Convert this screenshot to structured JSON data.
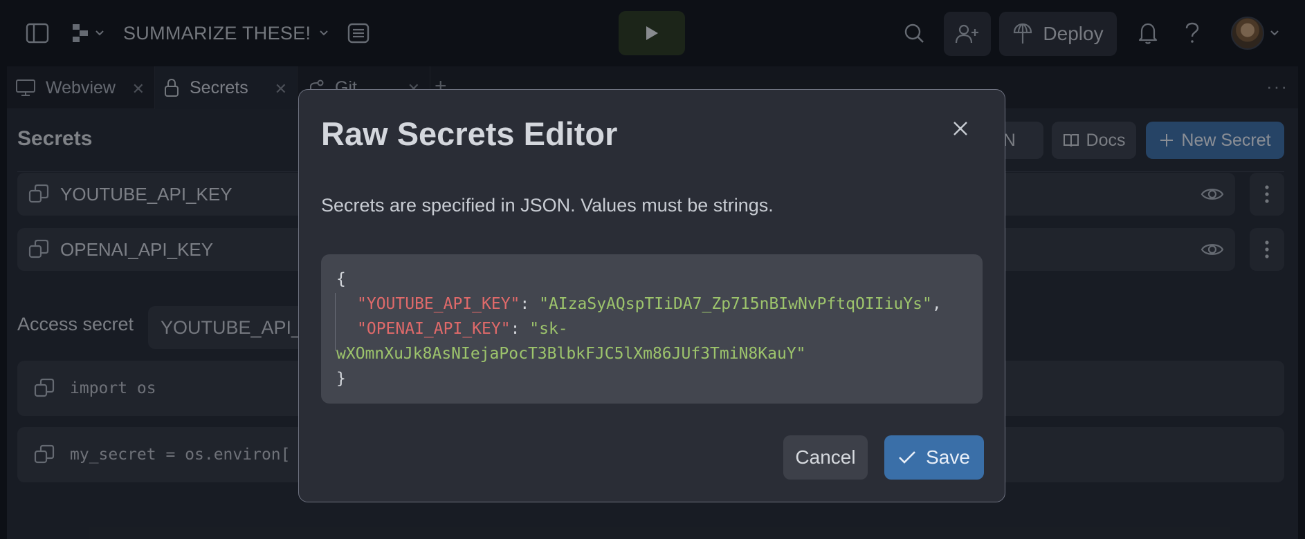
{
  "topbar": {
    "project_title": "SUMMARIZE THESE!",
    "deploy_label": "Deploy",
    "icons": {
      "sidebar": "sidebar-toggle-icon",
      "repl": "repl-icon",
      "tasks": "tasks-icon",
      "run": "play-icon",
      "search": "search-icon",
      "invite": "add-user-icon",
      "deploy": "deploy-icon",
      "bell": "bell-icon",
      "help": "help-icon"
    },
    "run_color": "#2c3a22",
    "run_icon_color": "#e6e8ec"
  },
  "tabs": [
    {
      "label": "Webview",
      "icon": "monitor-icon"
    },
    {
      "label": "Secrets",
      "icon": "lock-icon",
      "active": true
    },
    {
      "label": "Git",
      "icon": "git-icon"
    }
  ],
  "secrets_pane": {
    "title": "Secrets",
    "edit_as_json_label": "ON",
    "docs_label": "Docs",
    "new_secret_label": "New Secret",
    "rows": [
      {
        "key": "YOUTUBE_API_KEY"
      },
      {
        "key": "OPENAI_API_KEY"
      }
    ],
    "access_secret_label": "Access secret",
    "access_secret_value": "YOUTUBE_API_",
    "code_lines": [
      "import os",
      "my_secret = os.environ["
    ]
  },
  "modal": {
    "title": "Raw Secrets Editor",
    "description": "Secrets are specified in JSON. Values must be strings.",
    "editor": {
      "open_brace": "{",
      "close_brace": "}",
      "entries": [
        {
          "key": "\"YOUTUBE_API_KEY\"",
          "sep": ": ",
          "value": "\"AIzaSyAQspTIiDA7_Zp715nBIwNvPftqOIIiuYs\"",
          "trail": ","
        },
        {
          "key": "\"OPENAI_API_KEY\"",
          "sep": ": ",
          "value_part1": "\"sk-",
          "value_part2": "wXOmnXuJk8AsNIejaPocT3BlbkFJC5lXm86JUf3TmiN8KauY\""
        }
      ]
    },
    "cancel_label": "Cancel",
    "save_label": "Save",
    "accent_color": "#3a6fa8"
  }
}
